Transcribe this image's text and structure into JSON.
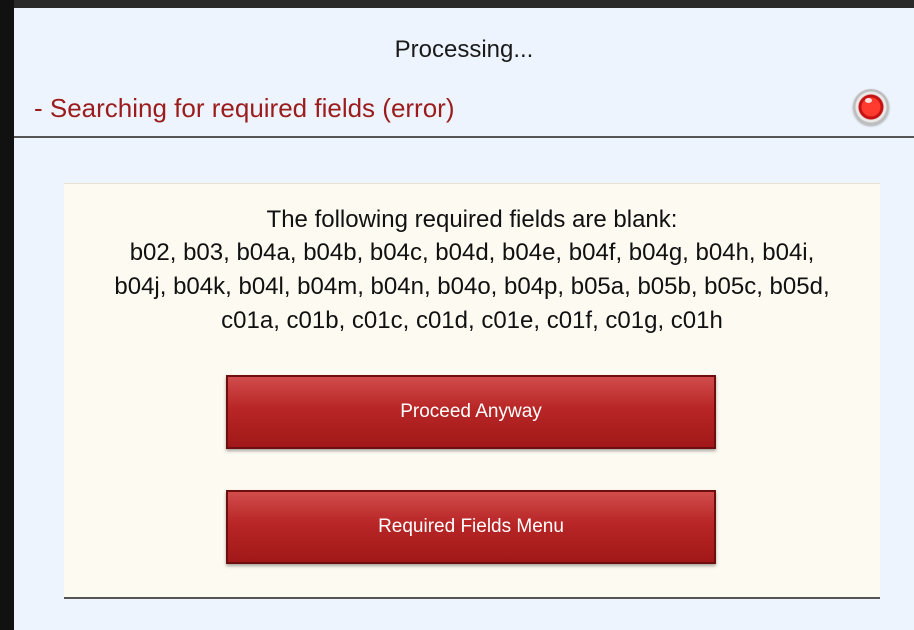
{
  "dialog": {
    "title": "Processing...",
    "status": {
      "text": "- Searching for required fields (error)",
      "indicator_icon": "red-status-light-icon",
      "color": "#9b1c1c"
    }
  },
  "message": {
    "heading": "The following required fields are blank:",
    "fields_lines": [
      "b02, b03, b04a, b04b, b04c, b04d, b04e, b04f, b04g, b04h, b04i,",
      "b04j, b04k, b04l, b04m, b04n, b04o, b04p, b05a, b05b, b05c, b05d,",
      "c01a, c01b, c01c, c01d, c01e, c01f, c01g, c01h"
    ]
  },
  "buttons": {
    "proceed_label": "Proceed Anyway",
    "menu_label": "Required Fields Menu",
    "color": "#b82626"
  }
}
